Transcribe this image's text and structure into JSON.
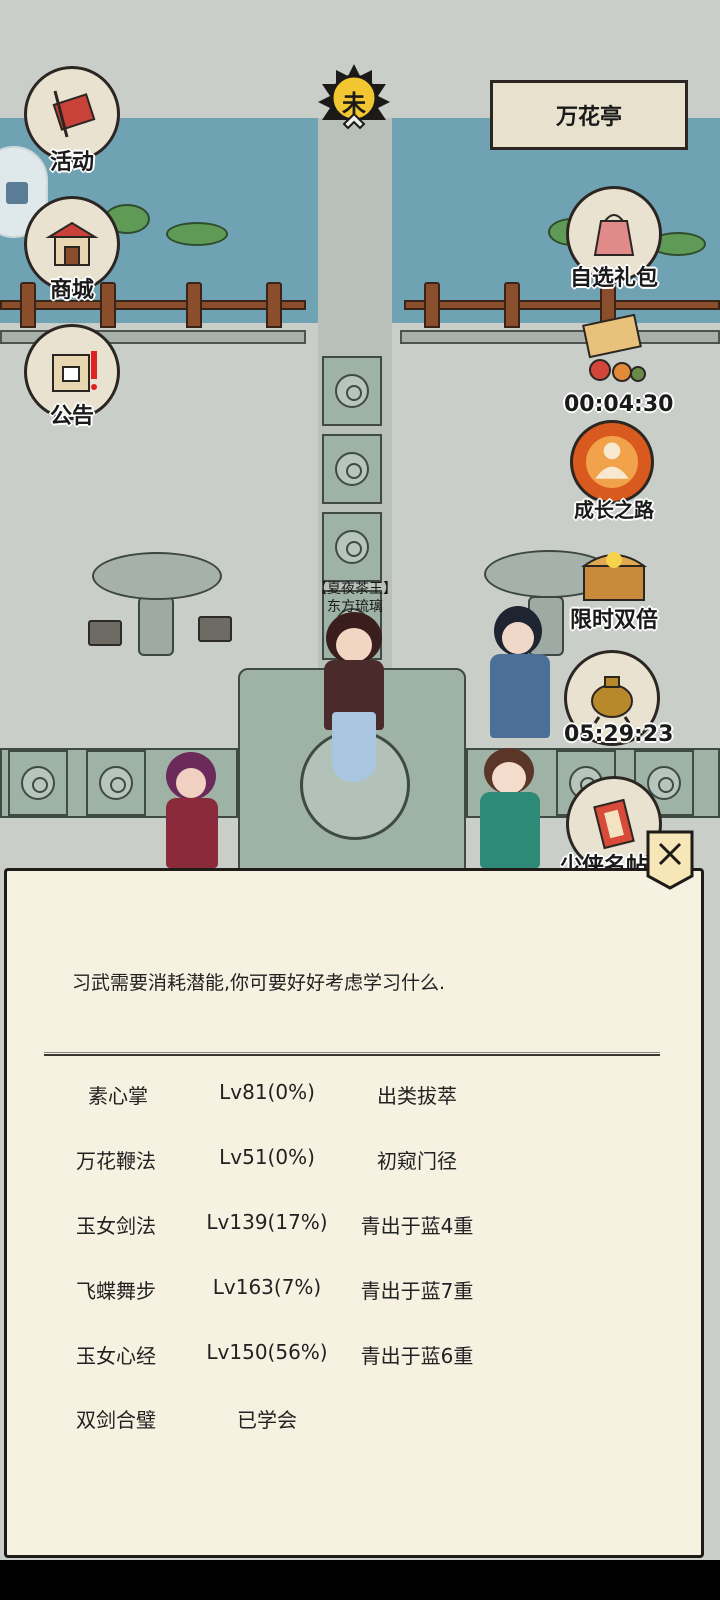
{
  "location": {
    "name": "万花亭"
  },
  "clock": {
    "glyph": "未"
  },
  "left_menu": [
    {
      "label": "活动",
      "icon": "banner-icon"
    },
    {
      "label": "商城",
      "icon": "shop-icon"
    },
    {
      "label": "公告",
      "icon": "notice-board-icon"
    }
  ],
  "right_menu": {
    "gift": {
      "label": "自选礼包",
      "icon": "gift-bag-icon"
    },
    "sale": {
      "timer": "00:04:30",
      "icon": "sale-sign-icon"
    },
    "growth": {
      "label": "成长之路",
      "icon": "growth-icon"
    },
    "double": {
      "label": "限时双倍",
      "icon": "treasure-chest-icon"
    },
    "incense": {
      "timer": "05:29:23",
      "icon": "incense-burner-icon"
    },
    "hero": {
      "label": "少侠名帖",
      "icon": "name-card-icon"
    }
  },
  "npc": {
    "title": "【夏夜茶王】",
    "name": "东方琉璃"
  },
  "dialog": {
    "intro": "习武需要消耗潜能,你可要好好考虑学习什么.",
    "skills": [
      {
        "name": "素心掌",
        "level": "Lv81(0%)",
        "rank": "出类拔萃"
      },
      {
        "name": "万花鞭法",
        "level": "Lv51(0%)",
        "rank": "初窥门径"
      },
      {
        "name": "玉女剑法",
        "level": "Lv139(17%)",
        "rank": "青出于蓝4重"
      },
      {
        "name": "飞蝶舞步",
        "level": "Lv163(7%)",
        "rank": "青出于蓝7重"
      },
      {
        "name": "玉女心经",
        "level": "Lv150(56%)",
        "rank": "青出于蓝6重"
      },
      {
        "name": "双剑合璧",
        "level": "已学会",
        "rank": ""
      }
    ]
  },
  "colors": {
    "water": "#6fa3b3",
    "paper": "#f7f1e1",
    "stone": "#9fb2a6"
  }
}
